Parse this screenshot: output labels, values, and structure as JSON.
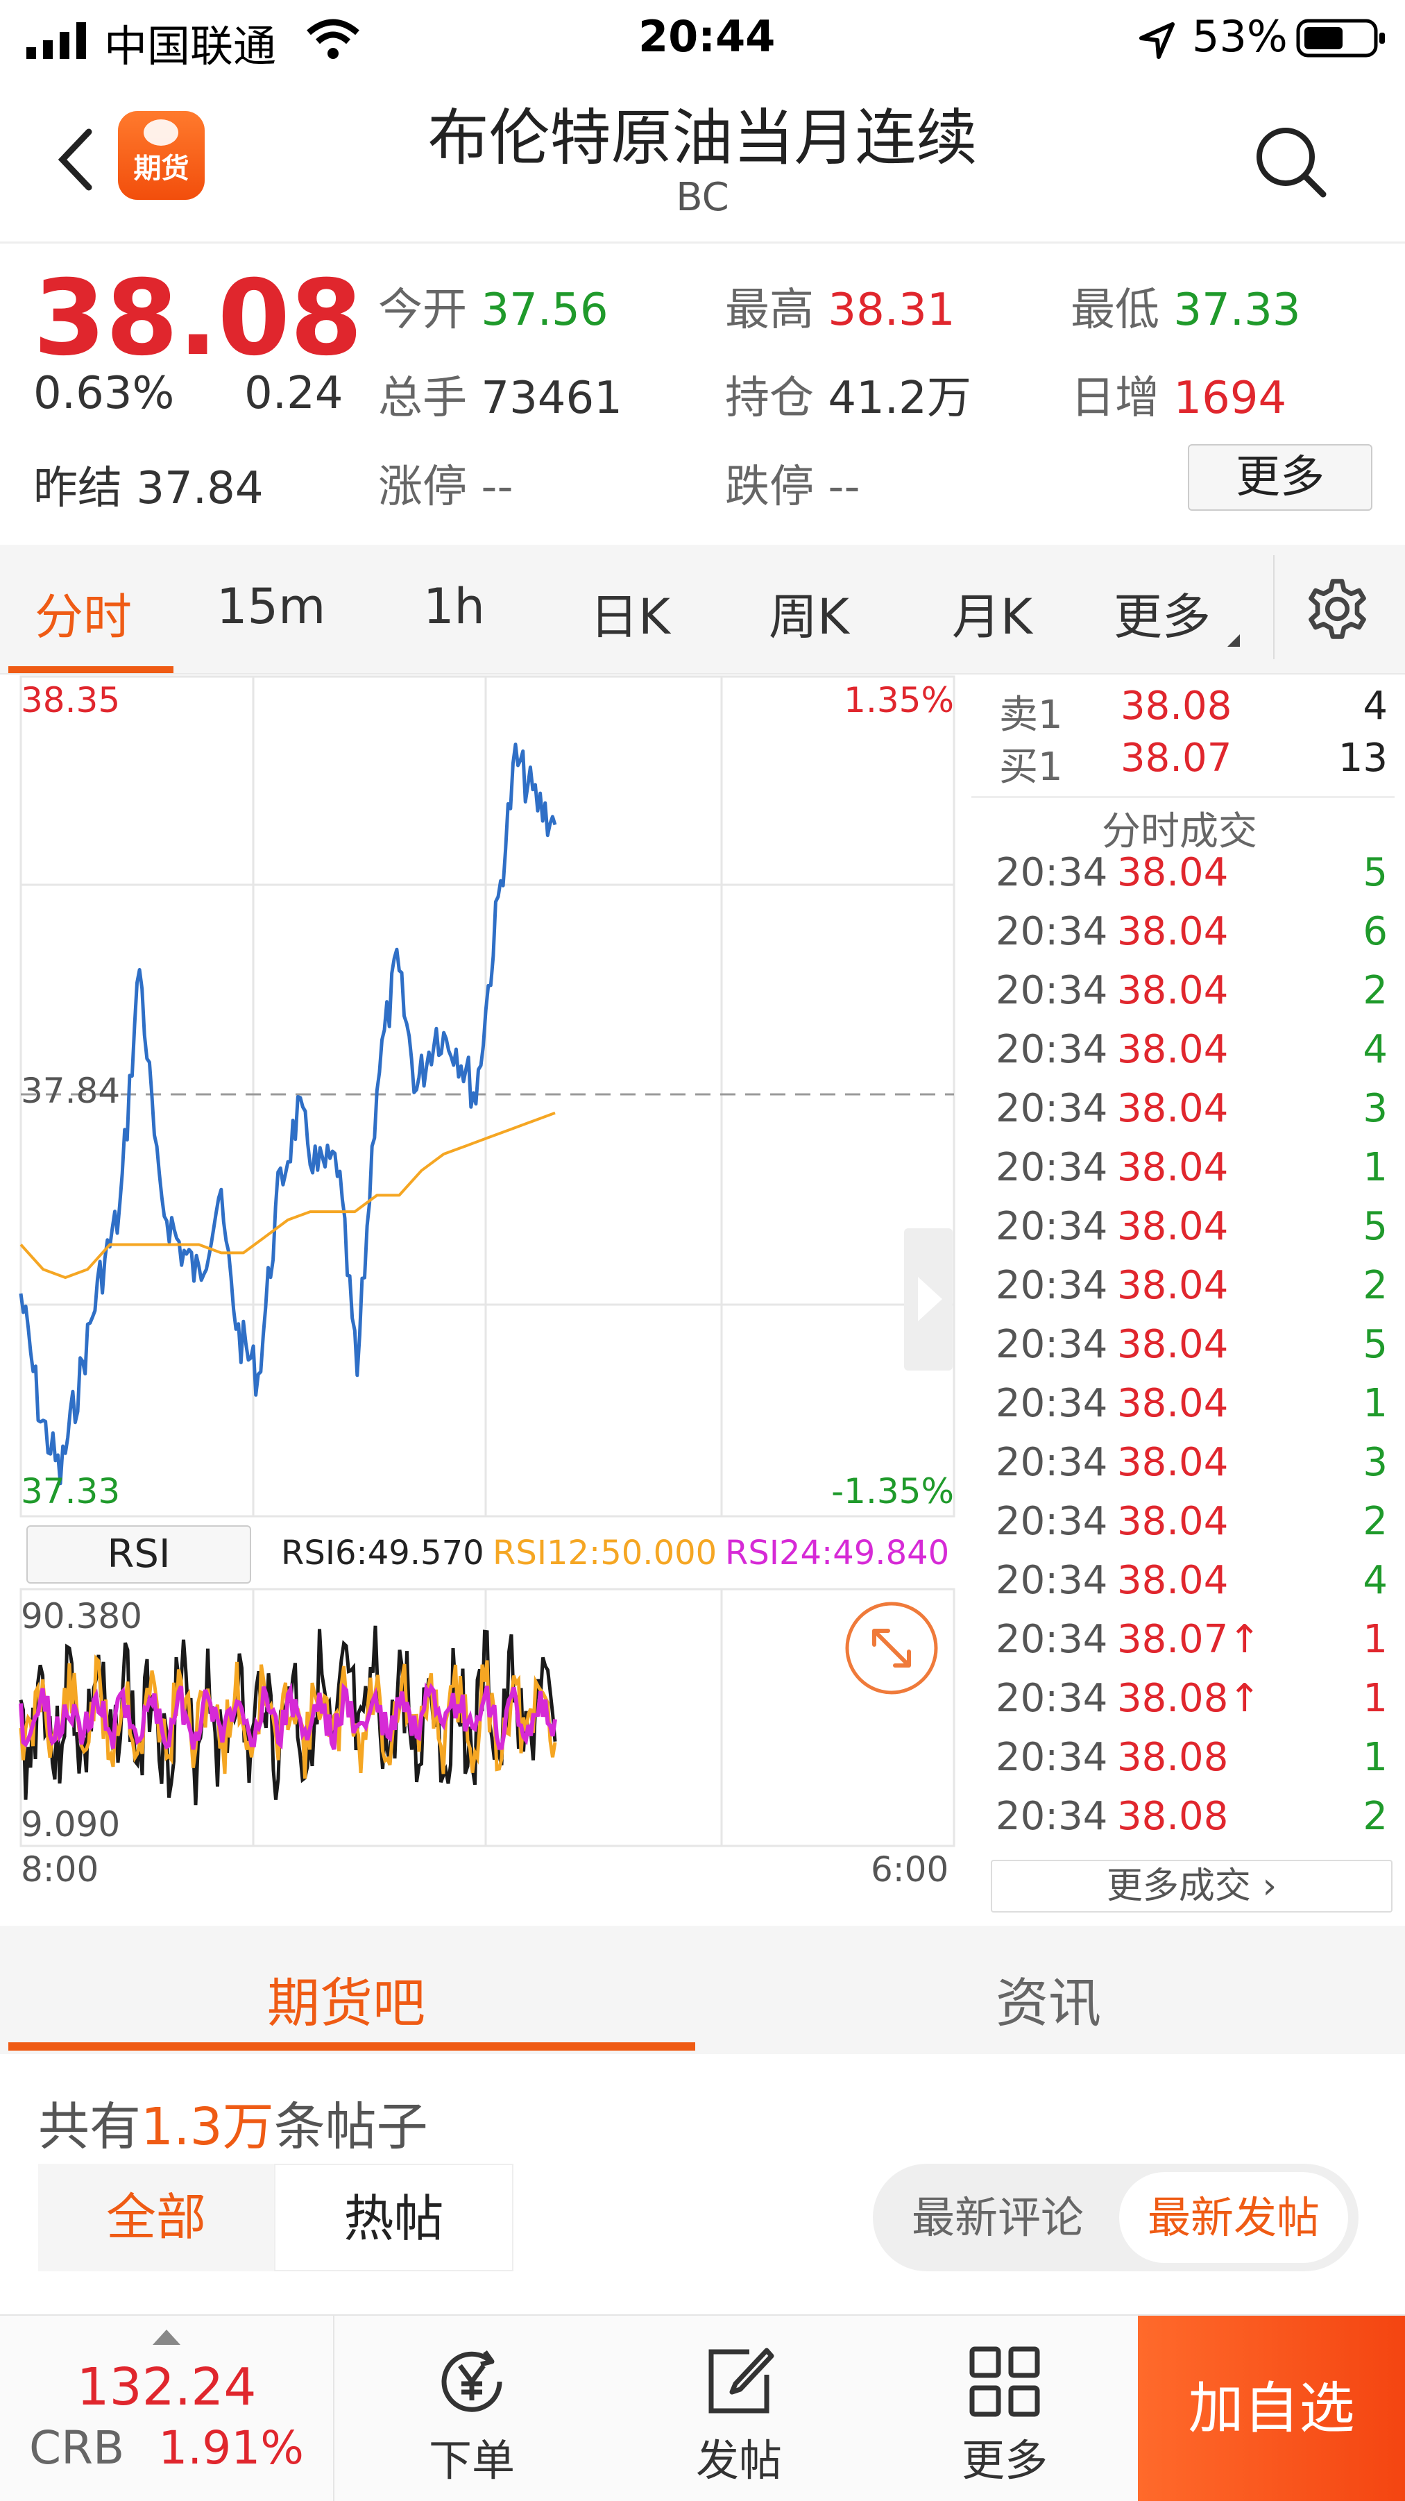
{
  "status_bar": {
    "carrier": "中国联通",
    "time": "20:44",
    "battery": "53%"
  },
  "nav": {
    "logo_text": "期货",
    "title": "布伦特原油当月连续",
    "code": "BC"
  },
  "quote": {
    "price": "38.08",
    "change_pct": "0.63%",
    "change": "0.24",
    "open_label": "今开",
    "open": "37.56",
    "high_label": "最高",
    "high": "38.31",
    "low_label": "最低",
    "low": "37.33",
    "volume_label": "总手",
    "volume": "73461",
    "oi_label": "持仓",
    "oi": "41.2万",
    "daily_inc_label": "日增",
    "daily_inc": "1694",
    "prev_settle_label": "昨结",
    "prev_settle": "37.84",
    "limit_up_label": "涨停",
    "limit_up": "--",
    "limit_down_label": "跌停",
    "limit_down": "--",
    "more_label": "更多"
  },
  "tabs": [
    {
      "label": "分时",
      "active": true
    },
    {
      "label": "15m"
    },
    {
      "label": "1h"
    },
    {
      "label": "日K"
    },
    {
      "label": "周K"
    },
    {
      "label": "月K"
    },
    {
      "label": "更多"
    }
  ],
  "chart": {
    "y_top": "38.35",
    "y_mid": "37.84",
    "y_bottom": "37.33",
    "pct_top": "1.35%",
    "pct_bottom": "-1.35%",
    "rsi_button": "RSI",
    "rsi6": "RSI6:49.570",
    "rsi12": "RSI12:50.000",
    "rsi24": "RSI24:49.840",
    "rsi_top": "90.380",
    "rsi_bottom": "9.090",
    "x_start": "8:00",
    "x_end": "6:00",
    "colors": {
      "price": "#2f6fc6",
      "avg": "#f5a623",
      "rsi6": "#1a1a1a",
      "rsi12": "#f5a623",
      "rsi24": "#d62ad6"
    }
  },
  "chart_data": {
    "type": "line",
    "x_range": [
      "8:00",
      "6:00"
    ],
    "ylim": [
      37.33,
      38.35
    ],
    "reference_line": 37.84,
    "series": [
      {
        "values": [
          37.6,
          37.45,
          37.38,
          37.5,
          37.62,
          37.7,
          38.0,
          37.72,
          37.66,
          37.62,
          37.72,
          37.55,
          37.5,
          37.72,
          37.82,
          37.75,
          37.76,
          37.5,
          37.86,
          38.0,
          37.85,
          37.92,
          37.9,
          37.84,
          38.05,
          38.25,
          38.2,
          38.17
        ]
      },
      {
        "values": [
          37.66,
          37.63,
          37.62,
          37.63,
          37.66,
          37.66,
          37.66,
          37.66,
          37.66,
          37.65,
          37.65,
          37.67,
          37.69,
          37.7,
          37.7,
          37.7,
          37.72,
          37.72,
          37.75,
          37.77,
          37.78,
          37.79,
          37.8,
          37.81,
          37.82
        ]
      }
    ]
  },
  "book": {
    "ask_label": "卖1",
    "ask_price": "38.08",
    "ask_vol": "4",
    "bid_label": "买1",
    "bid_price": "38.07",
    "bid_vol": "13",
    "ticks_title": "分时成交",
    "ticks": [
      {
        "time": "20:34",
        "price": "38.04",
        "vol": "5",
        "dir": "g"
      },
      {
        "time": "20:34",
        "price": "38.04",
        "vol": "6",
        "dir": "g"
      },
      {
        "time": "20:34",
        "price": "38.04",
        "vol": "2",
        "dir": "g"
      },
      {
        "time": "20:34",
        "price": "38.04",
        "vol": "4",
        "dir": "g"
      },
      {
        "time": "20:34",
        "price": "38.04",
        "vol": "3",
        "dir": "g"
      },
      {
        "time": "20:34",
        "price": "38.04",
        "vol": "1",
        "dir": "g"
      },
      {
        "time": "20:34",
        "price": "38.04",
        "vol": "5",
        "dir": "g"
      },
      {
        "time": "20:34",
        "price": "38.04",
        "vol": "2",
        "dir": "g"
      },
      {
        "time": "20:34",
        "price": "38.04",
        "vol": "5",
        "dir": "g"
      },
      {
        "time": "20:34",
        "price": "38.04",
        "vol": "1",
        "dir": "g"
      },
      {
        "time": "20:34",
        "price": "38.04",
        "vol": "3",
        "dir": "g"
      },
      {
        "time": "20:34",
        "price": "38.04",
        "vol": "2",
        "dir": "g"
      },
      {
        "time": "20:34",
        "price": "38.04",
        "vol": "4",
        "dir": "g"
      },
      {
        "time": "20:34",
        "price": "38.07↑",
        "vol": "1",
        "dir": "r"
      },
      {
        "time": "20:34",
        "price": "38.08↑",
        "vol": "1",
        "dir": "r"
      },
      {
        "time": "20:34",
        "price": "38.08",
        "vol": "1",
        "dir": "g"
      },
      {
        "time": "20:34",
        "price": "38.08",
        "vol": "2",
        "dir": "g"
      }
    ],
    "more_label": "更多成交 ›"
  },
  "forum": {
    "tab_active": "期货吧",
    "tab_other": "资讯",
    "count_prefix": "共有",
    "count": "1.3万",
    "count_suffix": "条帖子",
    "filter_all": "全部",
    "filter_hot": "热帖",
    "sort_comment": "最新评论",
    "sort_post": "最新发帖"
  },
  "bottom_bar": {
    "index_value": "132.24",
    "index_name": "CRB",
    "index_pct": "1.91%",
    "order_label": "下单",
    "post_label": "发帖",
    "more_label": "更多",
    "add_label": "加自选"
  }
}
